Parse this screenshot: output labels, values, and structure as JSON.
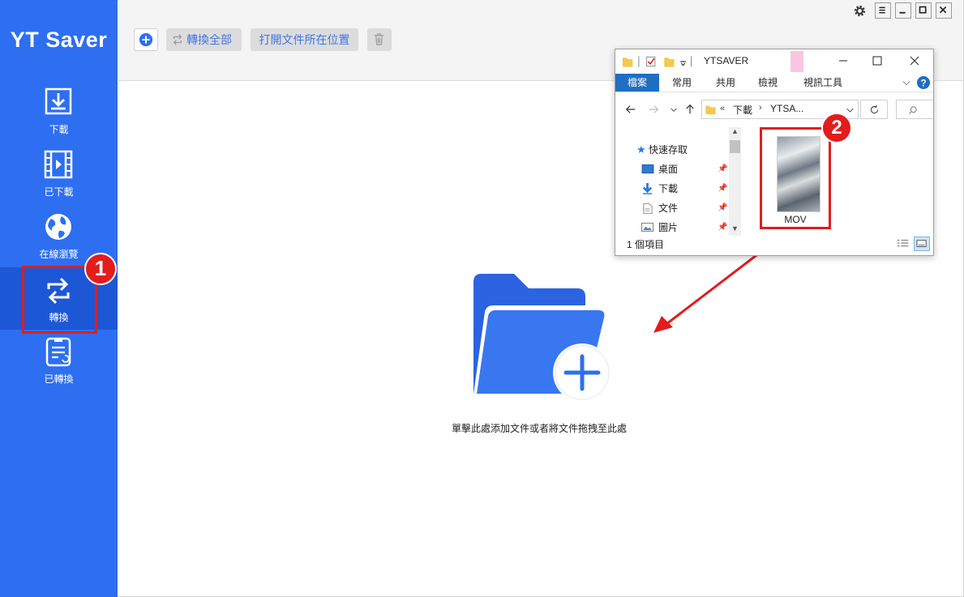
{
  "app": {
    "brand": "YT Saver"
  },
  "sidebar": {
    "items": [
      {
        "label": "下載",
        "icon": "download-icon"
      },
      {
        "label": "已下載",
        "icon": "film-icon"
      },
      {
        "label": "在線瀏覽",
        "icon": "globe-icon"
      },
      {
        "label": "轉換",
        "icon": "convert-icon",
        "active": true
      },
      {
        "label": "已轉換",
        "icon": "converted-doc-icon"
      }
    ]
  },
  "toolbar": {
    "add_icon": "plus-circle-icon",
    "convert_all_label": "轉換全部",
    "open_folder_label": "打開文件所在位置",
    "delete_icon": "trash-icon"
  },
  "window_controls": [
    "settings-icon",
    "menu-icon",
    "minimize-icon",
    "maximize-icon",
    "close-icon"
  ],
  "main": {
    "drop_hint": "單擊此處添加文件或者將文件拖拽至此處"
  },
  "explorer": {
    "title": "YTSAVER",
    "ribbon_tabs": [
      "檔案",
      "常用",
      "共用",
      "檢視",
      "視訊工具"
    ],
    "breadcrumb": {
      "prefix": "«",
      "parts": [
        "下載",
        "YTSA..."
      ]
    },
    "tree": [
      {
        "label": "快速存取",
        "icon": "star-icon"
      },
      {
        "label": "桌面",
        "icon": "desktop-icon"
      },
      {
        "label": "下載",
        "icon": "download-arrow-icon"
      },
      {
        "label": "文件",
        "icon": "document-icon"
      },
      {
        "label": "圖片",
        "icon": "picture-icon"
      }
    ],
    "file": {
      "name": "MOV"
    },
    "status": "1 個項目"
  },
  "annotations": {
    "step1": "1",
    "step2": "2"
  },
  "colors": {
    "sidebar": "#2d6ff0",
    "sidebar_active": "#1c57d6",
    "accent": "#3e76e6",
    "highlight": "#e31c1c"
  }
}
